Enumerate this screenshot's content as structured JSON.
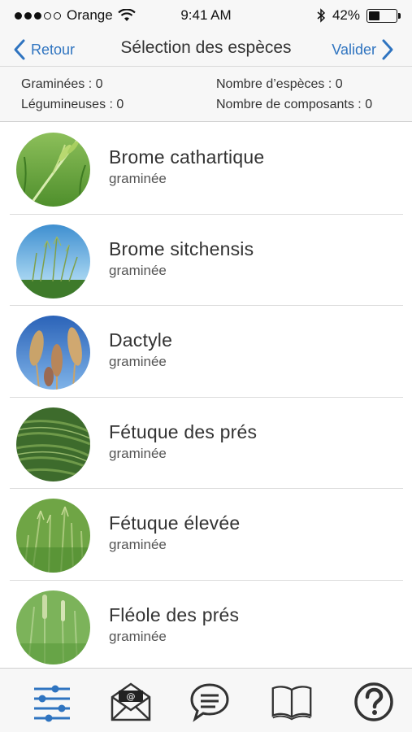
{
  "status_bar": {
    "carrier": "Orange",
    "time": "9:41 AM",
    "battery": "42%",
    "battery_level": 0.42,
    "signal_filled": 3,
    "signal_total": 5
  },
  "nav": {
    "back_label": "Retour",
    "title": "Sélection des espèces",
    "validate_label": "Valider",
    "accent_color": "#2f74c0"
  },
  "summary": {
    "graminees": "Graminées : 0",
    "legumineuses": "Légumineuses : 0",
    "nombre_especes": "Nombre d’espèces : 0",
    "nombre_composants": "Nombre de composants : 0"
  },
  "species": [
    {
      "name": "Brome cathartique",
      "type": "graminée",
      "image": "brome-cathartique-photo"
    },
    {
      "name": "Brome sitchensis",
      "type": "graminée",
      "image": "brome-sitchensis-photo"
    },
    {
      "name": "Dactyle",
      "type": "graminée",
      "image": "dactyle-photo"
    },
    {
      "name": "Fétuque des prés",
      "type": "graminée",
      "image": "fetuque-des-pres-photo"
    },
    {
      "name": "Fétuque élevée",
      "type": "graminée",
      "image": "fetuque-elevee-photo"
    },
    {
      "name": "Fléole des prés",
      "type": "graminée",
      "image": "fleole-des-pres-photo"
    }
  ],
  "tabs": [
    {
      "icon": "sliders-icon",
      "active": true
    },
    {
      "icon": "envelope-at-icon",
      "active": false
    },
    {
      "icon": "chat-bubble-icon",
      "active": false
    },
    {
      "icon": "book-icon",
      "active": false
    },
    {
      "icon": "help-icon",
      "active": false
    }
  ]
}
